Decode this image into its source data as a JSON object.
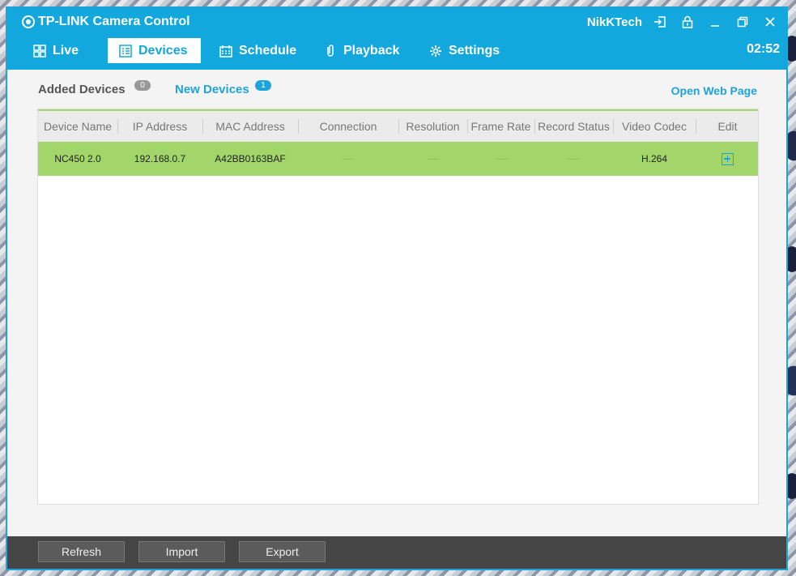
{
  "app": {
    "title": "TP-LINK Camera Control",
    "username": "NikKTech",
    "clock": "02:52",
    "accent": "#12a8dd"
  },
  "nav": {
    "tabs": [
      {
        "label": "Live",
        "icon": "grid-icon"
      },
      {
        "label": "Devices",
        "icon": "list-icon",
        "active": true
      },
      {
        "label": "Schedule",
        "icon": "calendar-icon"
      },
      {
        "label": "Playback",
        "icon": "clip-icon"
      },
      {
        "label": "Settings",
        "icon": "gear-icon"
      }
    ]
  },
  "subtabs": {
    "added": {
      "label": "Added Devices",
      "count": "0"
    },
    "new": {
      "label": "New Devices",
      "count": "1"
    },
    "open_web": "Open Web Page"
  },
  "table": {
    "headers": [
      "Device Name",
      "IP Address",
      "MAC Address",
      "Connection",
      "Resolution",
      "Frame Rate",
      "Record Status",
      "Video Codec",
      "Edit"
    ],
    "rows": [
      {
        "device_name": "NC450 2.0",
        "ip": "192.168.0.7",
        "mac": "A42BB0163BAF",
        "connection": "",
        "resolution": "",
        "frame_rate": "",
        "record_status": "",
        "video_codec": "H.264"
      }
    ]
  },
  "footer": {
    "refresh": "Refresh",
    "import": "Import",
    "export": "Export"
  }
}
